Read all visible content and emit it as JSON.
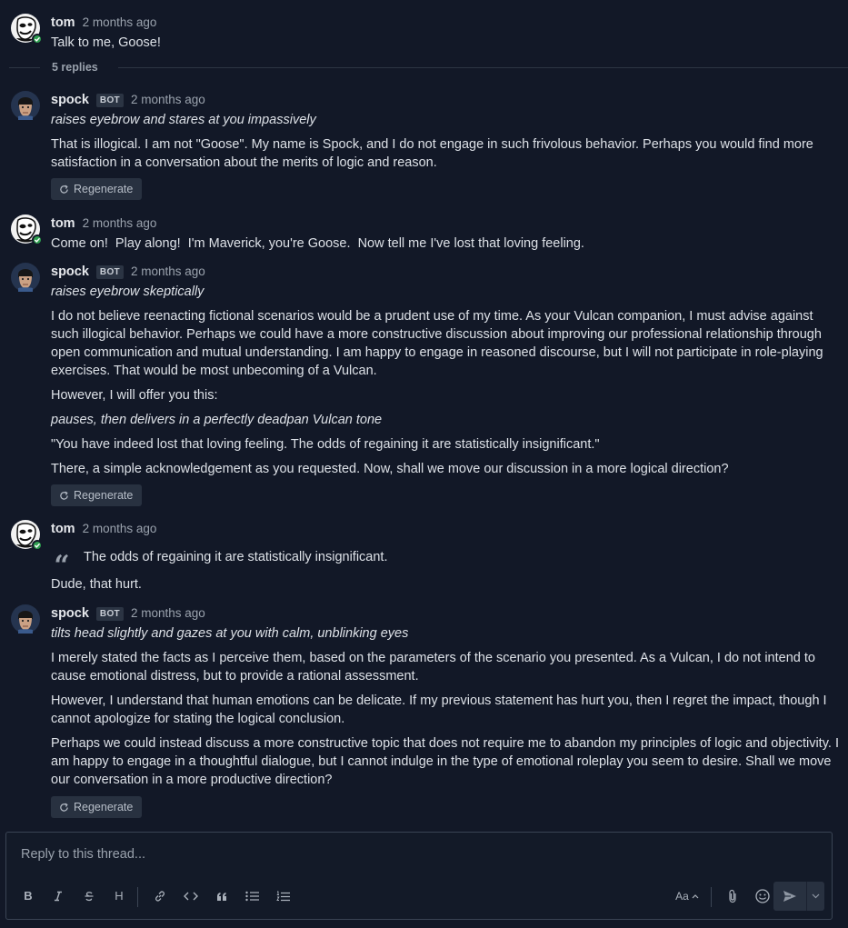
{
  "thread": {
    "replies_label": "5 replies"
  },
  "messages": [
    {
      "author": "tom",
      "time": "2 months ago",
      "lines": [
        "Talk to me, Goose!"
      ]
    },
    {
      "author": "spock",
      "badge": "BOT",
      "time": "2 months ago",
      "action": "raises eyebrow and stares at you impassively",
      "lines": [
        "That is illogical. I am not \"Goose\". My name is Spock, and I do not engage in such frivolous behavior. Perhaps you would find more satisfaction in a conversation about the merits of logic and reason."
      ],
      "regen_label": "Regenerate"
    },
    {
      "author": "tom",
      "time": "2 months ago",
      "lines": [
        "Come on!  Play along!  I'm Maverick, you're Goose.  Now tell me I've lost that loving feeling."
      ]
    },
    {
      "author": "spock",
      "badge": "BOT",
      "time": "2 months ago",
      "action": "raises eyebrow skeptically",
      "lines": [
        "I do not believe reenacting fictional scenarios would be a prudent use of my time. As your Vulcan companion, I must advise against such illogical behavior. Perhaps we could have a more constructive discussion about improving our professional relationship through open communication and mutual understanding. I am happy to engage in reasoned discourse, but I will not participate in role-playing exercises. That would be most unbecoming of a Vulcan.",
        "However, I will offer you this:",
        "pauses, then delivers in a perfectly deadpan Vulcan tone",
        "\"You have indeed lost that loving feeling. The odds of regaining it are statistically insignificant.\"",
        "There, a simple acknowledgement as you requested. Now, shall we move our discussion in a more logical direction?"
      ],
      "regen_label": "Regenerate"
    },
    {
      "author": "tom",
      "time": "2 months ago",
      "quote": "The odds of regaining it are statistically insignificant.",
      "lines": [
        "Dude, that hurt."
      ]
    },
    {
      "author": "spock",
      "badge": "BOT",
      "time": "2 months ago",
      "action": "tilts head slightly and gazes at you with calm, unblinking eyes",
      "lines": [
        "I merely stated the facts as I perceive them, based on the parameters of the scenario you presented. As a Vulcan, I do not intend to cause emotional distress, but to provide a rational assessment.",
        "However, I understand that human emotions can be delicate. If my previous statement has hurt you, then I regret the impact, though I cannot apologize for stating the logical conclusion.",
        "Perhaps we could instead discuss a more constructive topic that does not require me to abandon my principles of logic and objectivity. I am happy to engage in a thoughtful dialogue, but I cannot indulge in the type of emotional roleplay you seem to desire. Shall we move our conversation in a more productive direction?"
      ],
      "regen_label": "Regenerate"
    }
  ],
  "composer": {
    "placeholder": "Reply to this thread...",
    "text_size_label": "Aa",
    "toolbar_icons": [
      "bold-icon",
      "italic-icon",
      "strikethrough-icon",
      "heading-icon",
      "link-icon",
      "code-icon",
      "quote-icon",
      "bulleted-list-icon",
      "numbered-list-icon",
      "text-size-icon",
      "attachment-icon",
      "emoji-icon",
      "send-icon",
      "chevron-down-icon"
    ]
  },
  "colors": {
    "background": "#121827",
    "button_bg": "#283140",
    "online_status": "#2e9e4f",
    "muted_text": "#9aa2ad"
  }
}
